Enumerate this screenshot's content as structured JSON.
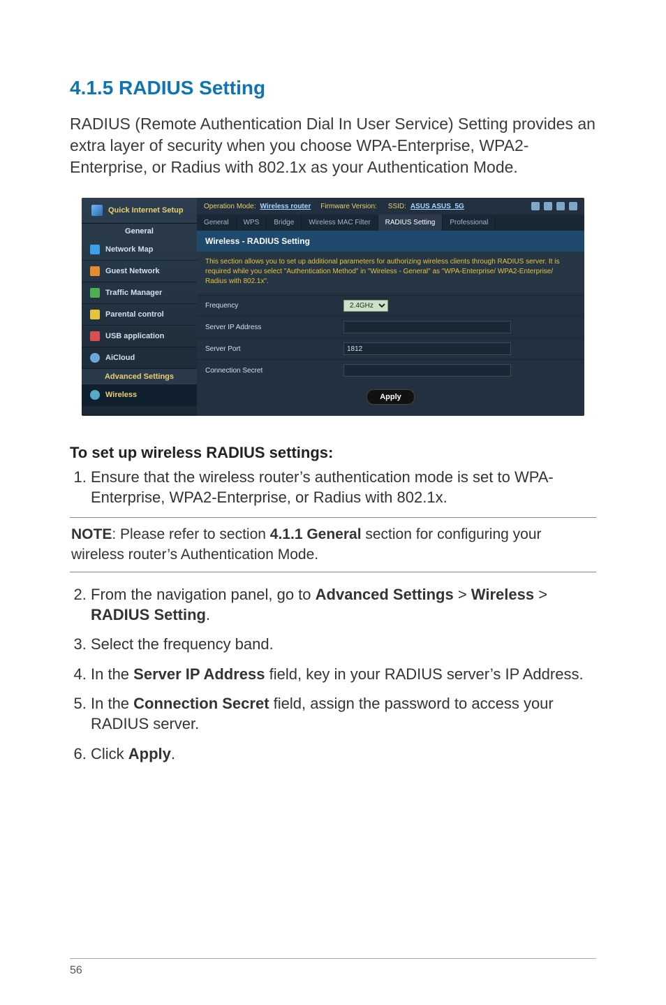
{
  "heading": "4.1.5 RADIUS Setting",
  "intro": "RADIUS (Remote Authentication Dial In User Service) Setting provides an extra layer of security when you choose WPA-Enterprise, WPA2-Enterprise, or Radius with 802.1x as your Authentication Mode.",
  "screenshot": {
    "quick_internet_setup": "Quick Internet Setup",
    "group_general": "General",
    "nav": {
      "network_map": "Network Map",
      "guest_network": "Guest Network",
      "traffic_manager": "Traffic Manager",
      "parental_control": "Parental control",
      "usb_application": "USB application",
      "aicloud": "AiCloud"
    },
    "group_advanced": "Advanced Settings",
    "nav_wireless": "Wireless",
    "topbar": {
      "op_mode_label": "Operation Mode:",
      "op_mode_value": "Wireless router",
      "fw_label": "Firmware Version:",
      "ssid_label": "SSID:",
      "ssid_value": "ASUS  ASUS_5G"
    },
    "tabs": {
      "general": "General",
      "wps": "WPS",
      "bridge": "Bridge",
      "mac_filter": "Wireless MAC Filter",
      "radius": "RADIUS Setting",
      "professional": "Professional"
    },
    "panel_title": "Wireless - RADIUS Setting",
    "panel_desc": "This section allows you to set up additional parameters for authorizing wireless clients through RADIUS server. It is required while you select \"Authentication Method\" in \"Wireless - General\" as \"WPA-Enterprise/ WPA2-Enterprise/ Radius with 802.1x\".",
    "form": {
      "frequency_label": "Frequency",
      "frequency_value": "2.4GHz",
      "server_ip_label": "Server IP Address",
      "server_ip_value": "",
      "server_port_label": "Server Port",
      "server_port_value": "1812",
      "secret_label": "Connection Secret",
      "secret_value": ""
    },
    "apply": "Apply"
  },
  "subhead": "To set up wireless RADIUS settings:",
  "step1": "Ensure that the wireless router’s authentication mode is set to WPA-Enterprise, WPA2-Enterprise, or Radius with 802.1x.",
  "note_label": "NOTE",
  "note_colon": ":  Please refer to section ",
  "note_ref": "4.1.1 General",
  "note_tail": " section for configuring your wireless router’s Authentication Mode.",
  "step2_a": "From the navigation panel, go to ",
  "step2_b": "Advanced Settings",
  "step2_gt1": " > ",
  "step2_c": "Wireless",
  "step2_gt2": " > ",
  "step2_d": "RADIUS Setting",
  "step2_e": ".",
  "step3": "Select the frequency band.",
  "step4_a": "In the ",
  "step4_b": "Server IP Address",
  "step4_c": " field, key in your RADIUS server’s IP Address.",
  "step5_a": "In the ",
  "step5_b": "Connection Secret",
  "step5_c": " field, assign the password to access your RADIUS server.",
  "step6_a": "Click ",
  "step6_b": "Apply",
  "step6_c": ".",
  "page_number": "56"
}
